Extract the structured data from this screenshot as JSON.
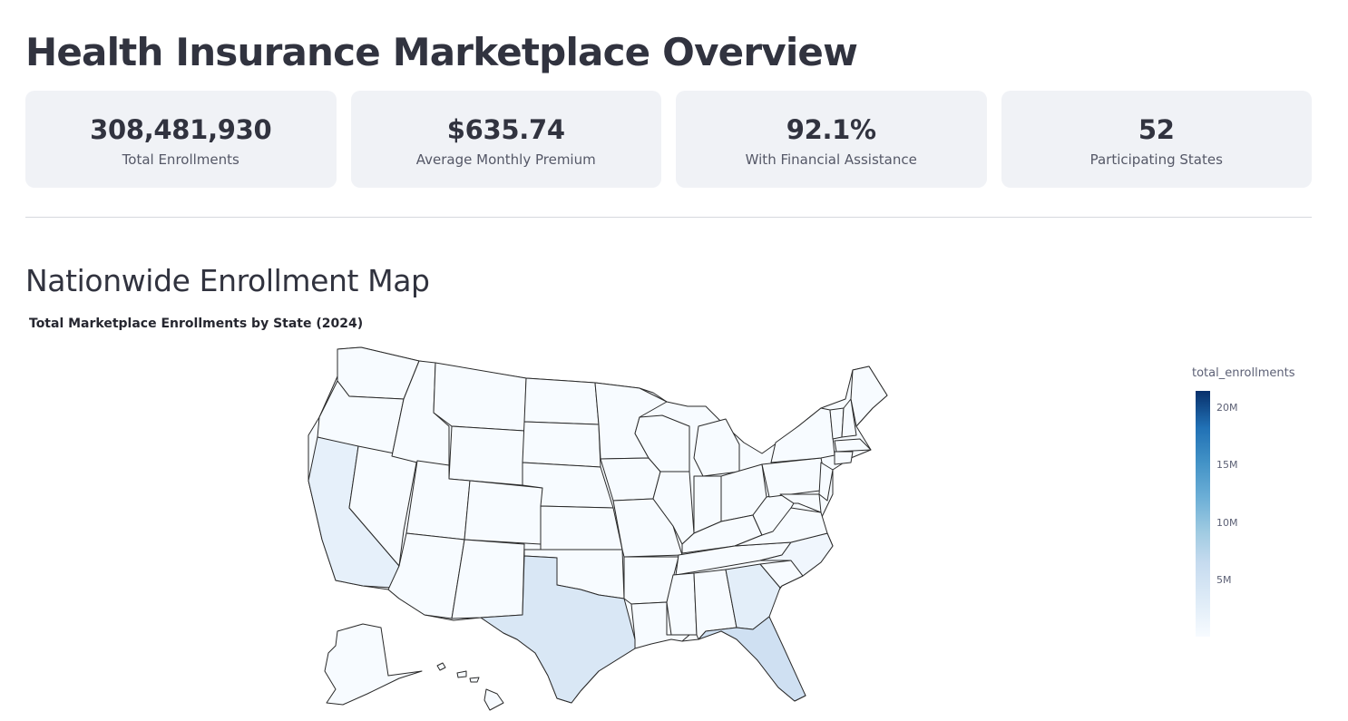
{
  "page": {
    "title": "Health Insurance Marketplace Overview"
  },
  "metrics": [
    {
      "value": "308,481,930",
      "label": "Total Enrollments"
    },
    {
      "value": "$635.74",
      "label": "Average Monthly Premium"
    },
    {
      "value": "92.1%",
      "label": "With Financial Assistance"
    },
    {
      "value": "52",
      "label": "Participating States"
    }
  ],
  "section": {
    "title": "Nationwide Enrollment Map"
  },
  "chart_data": {
    "type": "choropleth",
    "title": "Total Marketplace Enrollments by State (2024)",
    "colorbar": {
      "title": "total_enrollments",
      "ticks": [
        "5M",
        "10M",
        "15M",
        "20M"
      ],
      "range": [
        0,
        21800000
      ],
      "colorscale": "Blues"
    },
    "states": [
      {
        "state": "CA",
        "shade": "light"
      },
      {
        "state": "TX",
        "shade": "medium"
      },
      {
        "state": "FL",
        "shade": "medium"
      },
      {
        "state": "GA",
        "shade": "light"
      },
      {
        "state": "NC",
        "shade": "faint"
      },
      {
        "state": "other",
        "shade": "lightest"
      }
    ]
  }
}
